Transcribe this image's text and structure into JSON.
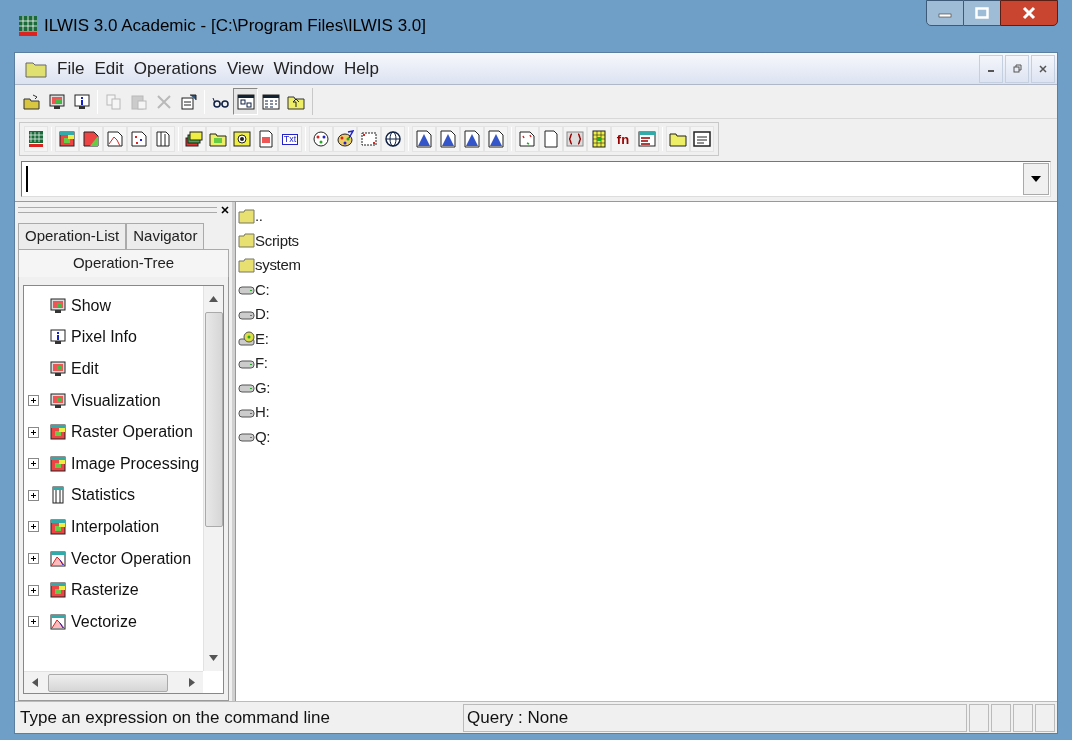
{
  "window": {
    "title": "ILWIS 3.0 Academic - [C:\\Program Files\\ILWIS 3.0]"
  },
  "menu": [
    "File",
    "Edit",
    "Operations",
    "View",
    "Window",
    "Help"
  ],
  "toolbar_1": [
    {
      "disabled": false,
      "selected": false
    },
    {
      "disabled": false,
      "selected": false
    },
    {
      "disabled": false,
      "selected": false
    },
    {
      "disabled": true,
      "selected": false
    },
    {
      "disabled": true,
      "selected": false
    },
    {
      "disabled": true,
      "selected": false
    },
    {
      "disabled": false,
      "selected": false
    },
    {
      "disabled": false,
      "selected": false
    },
    {
      "disabled": false,
      "selected": true
    },
    {
      "disabled": false,
      "selected": false
    },
    {
      "disabled": false,
      "selected": false
    }
  ],
  "toolbar_2_labels": {
    "text_icon": "Txt",
    "function_icon": "fn"
  },
  "panel": {
    "tabs": [
      {
        "label": "Operation-List",
        "selected": false
      },
      {
        "label": "Navigator",
        "selected": false
      },
      {
        "label": "Operation-Tree",
        "selected": true
      }
    ],
    "tree": [
      {
        "label": "Show",
        "expandable": false
      },
      {
        "label": "Pixel Info",
        "expandable": false
      },
      {
        "label": "Edit",
        "expandable": false
      },
      {
        "label": "Visualization",
        "expandable": true
      },
      {
        "label": "Raster Operation",
        "expandable": true
      },
      {
        "label": "Image Processing",
        "expandable": true
      },
      {
        "label": "Statistics",
        "expandable": true
      },
      {
        "label": "Interpolation",
        "expandable": true
      },
      {
        "label": "Vector Operation",
        "expandable": true
      },
      {
        "label": "Rasterize",
        "expandable": true
      },
      {
        "label": "Vectorize",
        "expandable": true
      }
    ]
  },
  "files": [
    {
      "name": "..",
      "kind": "folder"
    },
    {
      "name": "Scripts",
      "kind": "folder"
    },
    {
      "name": "system",
      "kind": "folder"
    },
    {
      "name": "C:",
      "kind": "drive"
    },
    {
      "name": "D:",
      "kind": "drive"
    },
    {
      "name": "E:",
      "kind": "cdrom"
    },
    {
      "name": "F:",
      "kind": "drive"
    },
    {
      "name": "G:",
      "kind": "drive"
    },
    {
      "name": "H:",
      "kind": "drive"
    },
    {
      "name": "Q:",
      "kind": "drive"
    }
  ],
  "status_bar": [
    "Type an expression on the command line",
    "Query : None"
  ]
}
